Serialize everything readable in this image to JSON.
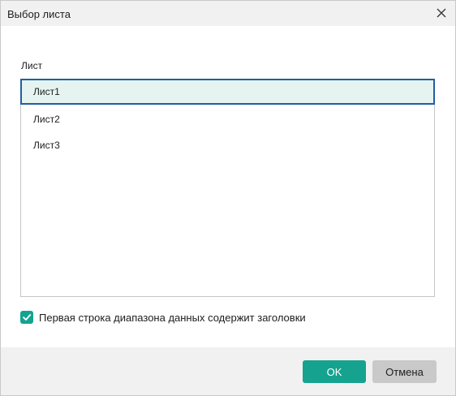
{
  "window": {
    "title": "Выбор листа",
    "close_icon": "close-icon"
  },
  "list": {
    "label": "Лист",
    "items": [
      {
        "label": "Лист1",
        "selected": true
      },
      {
        "label": "Лист2",
        "selected": false
      },
      {
        "label": "Лист3",
        "selected": false
      }
    ]
  },
  "options": {
    "header_row_label": "Первая строка диапазона данных содержит заголовки",
    "header_row_checked": true
  },
  "buttons": {
    "ok_label": "OK",
    "cancel_label": "Отмена"
  },
  "colors": {
    "accent": "#15a38f",
    "selection_border": "#1f5fa2",
    "selection_fill": "#e5f4f1"
  }
}
